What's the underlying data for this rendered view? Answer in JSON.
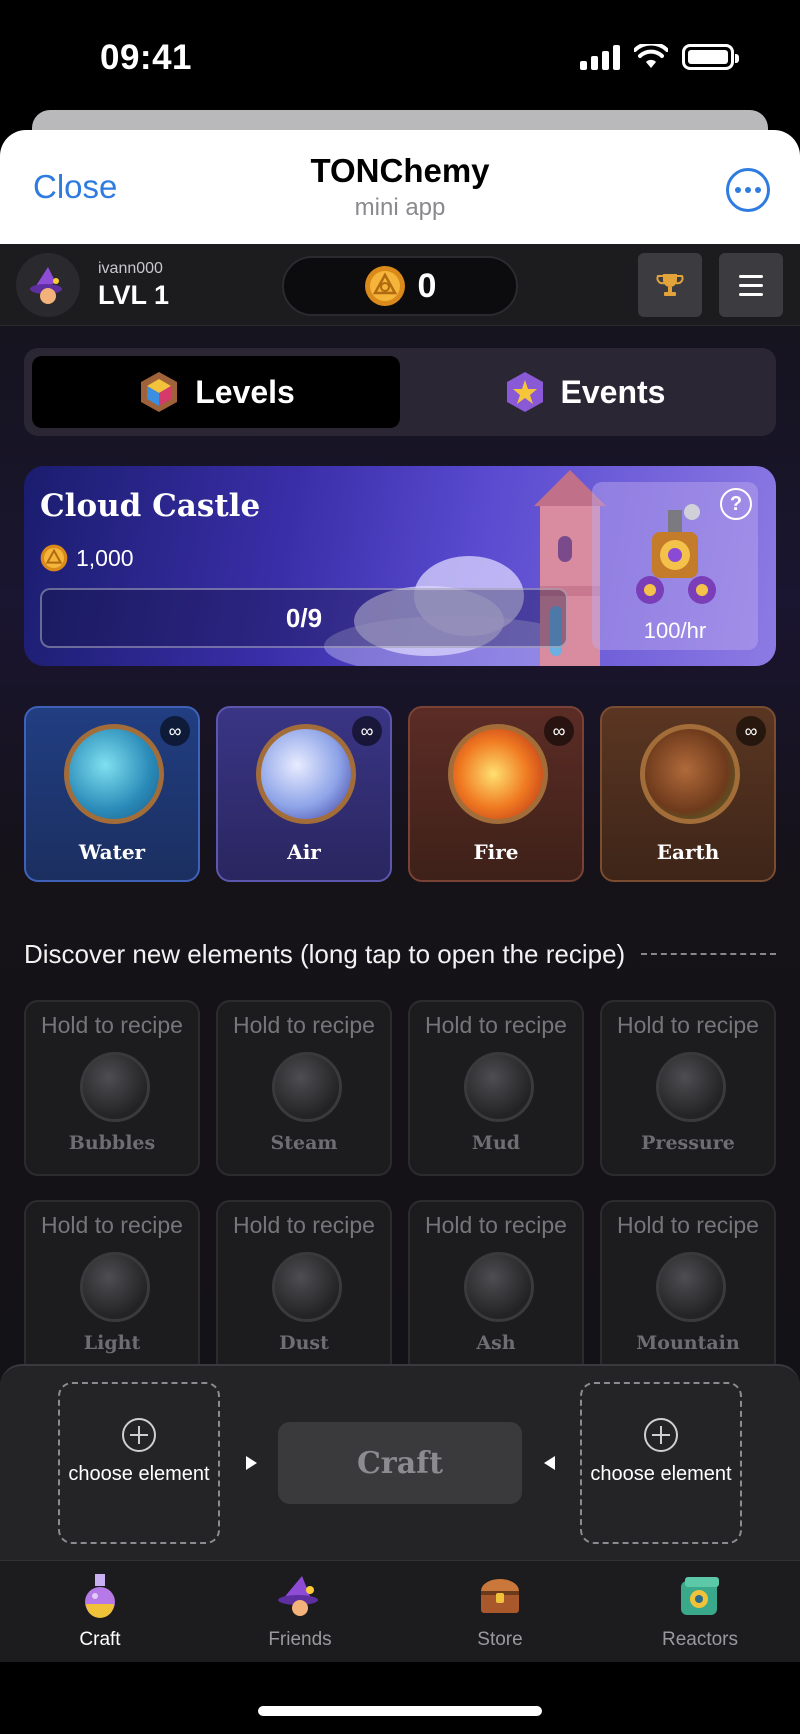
{
  "status_bar": {
    "time": "09:41"
  },
  "header": {
    "close_label": "Close",
    "title": "TONChemy",
    "subtitle": "mini app"
  },
  "user": {
    "name": "ivann000",
    "level": "LVL 1"
  },
  "balance": {
    "coins": "0"
  },
  "tabs": [
    {
      "label": "Levels",
      "active": true
    },
    {
      "label": "Events",
      "active": false
    }
  ],
  "level_card": {
    "title": "Cloud Castle",
    "reward": "1,000",
    "progress": "0/9",
    "progress_fraction": 0,
    "rate": "100/hr",
    "help": "?"
  },
  "base_elements": [
    {
      "name": "Water",
      "badge": "∞"
    },
    {
      "name": "Air",
      "badge": "∞"
    },
    {
      "name": "Fire",
      "badge": "∞"
    },
    {
      "name": "Earth",
      "badge": "∞"
    }
  ],
  "discover_heading": "Discover new elements (long tap to open the recipe)",
  "locked_elements": [
    {
      "hint": "Hold to recipe",
      "name": "Bubbles"
    },
    {
      "hint": "Hold to recipe",
      "name": "Steam"
    },
    {
      "hint": "Hold to recipe",
      "name": "Mud"
    },
    {
      "hint": "Hold to recipe",
      "name": "Pressure"
    },
    {
      "hint": "Hold to recipe",
      "name": "Light"
    },
    {
      "hint": "Hold to recipe",
      "name": "Dust"
    },
    {
      "hint": "Hold to recipe",
      "name": "Ash"
    },
    {
      "hint": "Hold to recipe",
      "name": "Mountain"
    }
  ],
  "craft": {
    "slot_left": "choose element",
    "slot_right": "choose element",
    "button": "Craft"
  },
  "nav": [
    {
      "label": "Craft",
      "icon": "potion-icon",
      "active": true
    },
    {
      "label": "Friends",
      "icon": "wizard-icon",
      "active": false
    },
    {
      "label": "Store",
      "icon": "chest-icon",
      "active": false
    },
    {
      "label": "Reactors",
      "icon": "reactor-icon",
      "active": false
    }
  ],
  "colors": {
    "accent_blue": "#2f7ce0",
    "coin_gold": "#f0a82a",
    "water": "#213e82",
    "air": "#3a3585",
    "fire": "#5b2c25",
    "earth": "#5a3622"
  }
}
